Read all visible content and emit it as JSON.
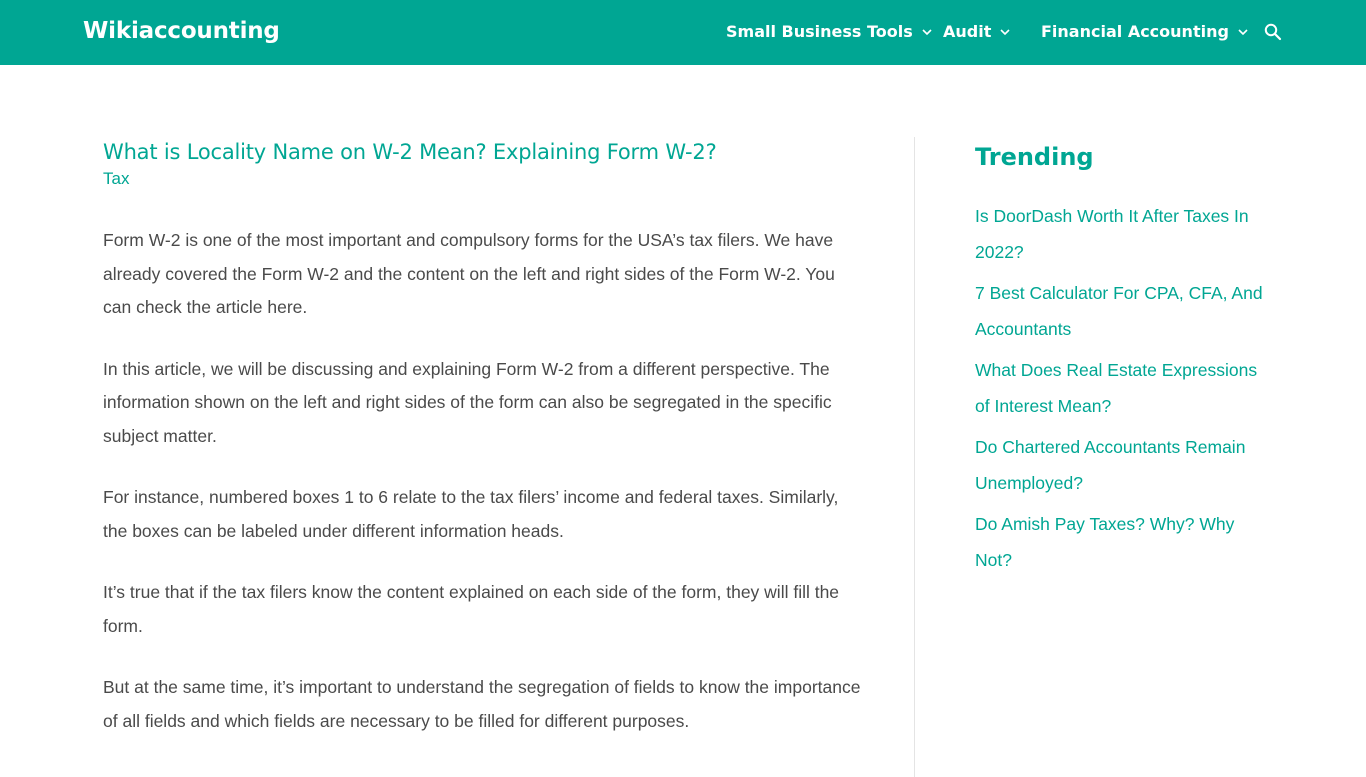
{
  "site": {
    "logo": "Wikiaccounting"
  },
  "nav": {
    "items": [
      {
        "label": "Small Business Tools"
      },
      {
        "label": "Audit"
      },
      {
        "label": "Financial Accounting"
      }
    ],
    "search_icon": "search-icon",
    "chevron_icon": "chevron-down-icon"
  },
  "article": {
    "title": "What is Locality Name on W-2 Mean? Explaining Form W-2?",
    "category": "Tax",
    "paragraphs": [
      "Form W-2 is one of the most important and compulsory forms for the USA’s tax filers. We have already covered the Form W-2 and the content on the left and right sides of the Form W-2. You can check the article here.",
      "In this article, we will be discussing and explaining Form W-2 from a different perspective. The information shown on the left and right sides of the form can also be segregated in the specific subject matter.",
      "For instance, numbered boxes 1 to 6 relate to the tax filers’ income and federal taxes. Similarly, the boxes can be labeled under different information heads.",
      "It’s true that if the tax filers know the content explained on each side of the form, they will fill the form.",
      "But at the same time, it’s important to understand the segregation of fields to know the importance of all fields and which fields are necessary to be filled for different purposes."
    ]
  },
  "sidebar": {
    "title": "Trending",
    "items": [
      "Is DoorDash Worth It After Taxes In 2022?",
      "7 Best Calculator For CPA, CFA, And Accountants",
      "What Does Real Estate Expressions of Interest Mean?",
      "Do Chartered Accountants Remain Unemployed?",
      "Do Amish Pay Taxes? Why? Why Not?"
    ]
  },
  "colors": {
    "brand": "#00a693",
    "text": "#4a4a4a",
    "background": "#ffffff"
  }
}
